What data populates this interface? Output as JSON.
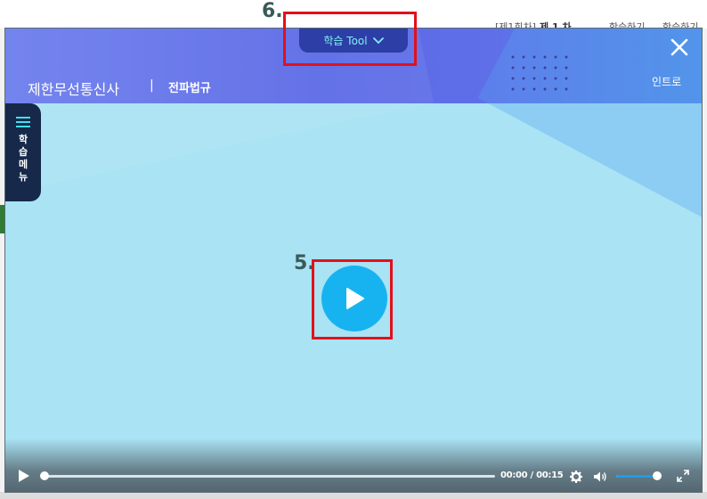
{
  "annotations": {
    "step5": "5.",
    "step6": "6."
  },
  "background": {
    "top_text_fragments": [
      "[제1회차]",
      "제 1 차",
      "학습하기",
      "학습하기"
    ]
  },
  "header": {
    "course_title": "제한무선통신사",
    "divider": "|",
    "chapter_title": "전파법규",
    "intro_label": "인트로",
    "close_label": "✕",
    "tool_button_label": "학습 Tool"
  },
  "side_menu": {
    "label": "학습메뉴"
  },
  "player": {
    "time_current": "00:00",
    "time_separator": "/",
    "time_total": "00:15",
    "progress_fraction": 0,
    "volume_fraction": 0.92
  },
  "colors": {
    "header": "#5b6ae6",
    "video_bg": "#a9e3f4",
    "play_button": "#17b3f1",
    "tool_button": "#2d3ea6",
    "side_menu": "#16294a",
    "highlight": "#e3101a",
    "volume_fill": "#1d9bf0"
  },
  "icons": [
    "close-icon",
    "chevron-down-icon",
    "hamburger-icon",
    "play-icon",
    "gear-icon",
    "volume-icon",
    "fullscreen-icon"
  ]
}
